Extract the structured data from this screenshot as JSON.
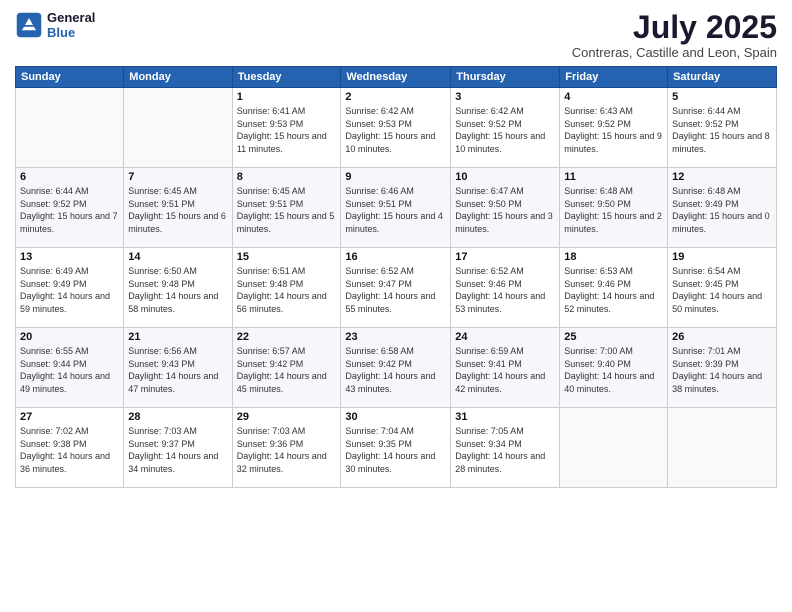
{
  "header": {
    "logo_general": "General",
    "logo_blue": "Blue",
    "title": "July 2025",
    "subtitle": "Contreras, Castille and Leon, Spain"
  },
  "weekdays": [
    "Sunday",
    "Monday",
    "Tuesday",
    "Wednesday",
    "Thursday",
    "Friday",
    "Saturday"
  ],
  "weeks": [
    [
      {
        "day": "",
        "info": ""
      },
      {
        "day": "",
        "info": ""
      },
      {
        "day": "1",
        "info": "Sunrise: 6:41 AM\nSunset: 9:53 PM\nDaylight: 15 hours and 11 minutes."
      },
      {
        "day": "2",
        "info": "Sunrise: 6:42 AM\nSunset: 9:53 PM\nDaylight: 15 hours and 10 minutes."
      },
      {
        "day": "3",
        "info": "Sunrise: 6:42 AM\nSunset: 9:52 PM\nDaylight: 15 hours and 10 minutes."
      },
      {
        "day": "4",
        "info": "Sunrise: 6:43 AM\nSunset: 9:52 PM\nDaylight: 15 hours and 9 minutes."
      },
      {
        "day": "5",
        "info": "Sunrise: 6:44 AM\nSunset: 9:52 PM\nDaylight: 15 hours and 8 minutes."
      }
    ],
    [
      {
        "day": "6",
        "info": "Sunrise: 6:44 AM\nSunset: 9:52 PM\nDaylight: 15 hours and 7 minutes."
      },
      {
        "day": "7",
        "info": "Sunrise: 6:45 AM\nSunset: 9:51 PM\nDaylight: 15 hours and 6 minutes."
      },
      {
        "day": "8",
        "info": "Sunrise: 6:45 AM\nSunset: 9:51 PM\nDaylight: 15 hours and 5 minutes."
      },
      {
        "day": "9",
        "info": "Sunrise: 6:46 AM\nSunset: 9:51 PM\nDaylight: 15 hours and 4 minutes."
      },
      {
        "day": "10",
        "info": "Sunrise: 6:47 AM\nSunset: 9:50 PM\nDaylight: 15 hours and 3 minutes."
      },
      {
        "day": "11",
        "info": "Sunrise: 6:48 AM\nSunset: 9:50 PM\nDaylight: 15 hours and 2 minutes."
      },
      {
        "day": "12",
        "info": "Sunrise: 6:48 AM\nSunset: 9:49 PM\nDaylight: 15 hours and 0 minutes."
      }
    ],
    [
      {
        "day": "13",
        "info": "Sunrise: 6:49 AM\nSunset: 9:49 PM\nDaylight: 14 hours and 59 minutes."
      },
      {
        "day": "14",
        "info": "Sunrise: 6:50 AM\nSunset: 9:48 PM\nDaylight: 14 hours and 58 minutes."
      },
      {
        "day": "15",
        "info": "Sunrise: 6:51 AM\nSunset: 9:48 PM\nDaylight: 14 hours and 56 minutes."
      },
      {
        "day": "16",
        "info": "Sunrise: 6:52 AM\nSunset: 9:47 PM\nDaylight: 14 hours and 55 minutes."
      },
      {
        "day": "17",
        "info": "Sunrise: 6:52 AM\nSunset: 9:46 PM\nDaylight: 14 hours and 53 minutes."
      },
      {
        "day": "18",
        "info": "Sunrise: 6:53 AM\nSunset: 9:46 PM\nDaylight: 14 hours and 52 minutes."
      },
      {
        "day": "19",
        "info": "Sunrise: 6:54 AM\nSunset: 9:45 PM\nDaylight: 14 hours and 50 minutes."
      }
    ],
    [
      {
        "day": "20",
        "info": "Sunrise: 6:55 AM\nSunset: 9:44 PM\nDaylight: 14 hours and 49 minutes."
      },
      {
        "day": "21",
        "info": "Sunrise: 6:56 AM\nSunset: 9:43 PM\nDaylight: 14 hours and 47 minutes."
      },
      {
        "day": "22",
        "info": "Sunrise: 6:57 AM\nSunset: 9:42 PM\nDaylight: 14 hours and 45 minutes."
      },
      {
        "day": "23",
        "info": "Sunrise: 6:58 AM\nSunset: 9:42 PM\nDaylight: 14 hours and 43 minutes."
      },
      {
        "day": "24",
        "info": "Sunrise: 6:59 AM\nSunset: 9:41 PM\nDaylight: 14 hours and 42 minutes."
      },
      {
        "day": "25",
        "info": "Sunrise: 7:00 AM\nSunset: 9:40 PM\nDaylight: 14 hours and 40 minutes."
      },
      {
        "day": "26",
        "info": "Sunrise: 7:01 AM\nSunset: 9:39 PM\nDaylight: 14 hours and 38 minutes."
      }
    ],
    [
      {
        "day": "27",
        "info": "Sunrise: 7:02 AM\nSunset: 9:38 PM\nDaylight: 14 hours and 36 minutes."
      },
      {
        "day": "28",
        "info": "Sunrise: 7:03 AM\nSunset: 9:37 PM\nDaylight: 14 hours and 34 minutes."
      },
      {
        "day": "29",
        "info": "Sunrise: 7:03 AM\nSunset: 9:36 PM\nDaylight: 14 hours and 32 minutes."
      },
      {
        "day": "30",
        "info": "Sunrise: 7:04 AM\nSunset: 9:35 PM\nDaylight: 14 hours and 30 minutes."
      },
      {
        "day": "31",
        "info": "Sunrise: 7:05 AM\nSunset: 9:34 PM\nDaylight: 14 hours and 28 minutes."
      },
      {
        "day": "",
        "info": ""
      },
      {
        "day": "",
        "info": ""
      }
    ]
  ]
}
